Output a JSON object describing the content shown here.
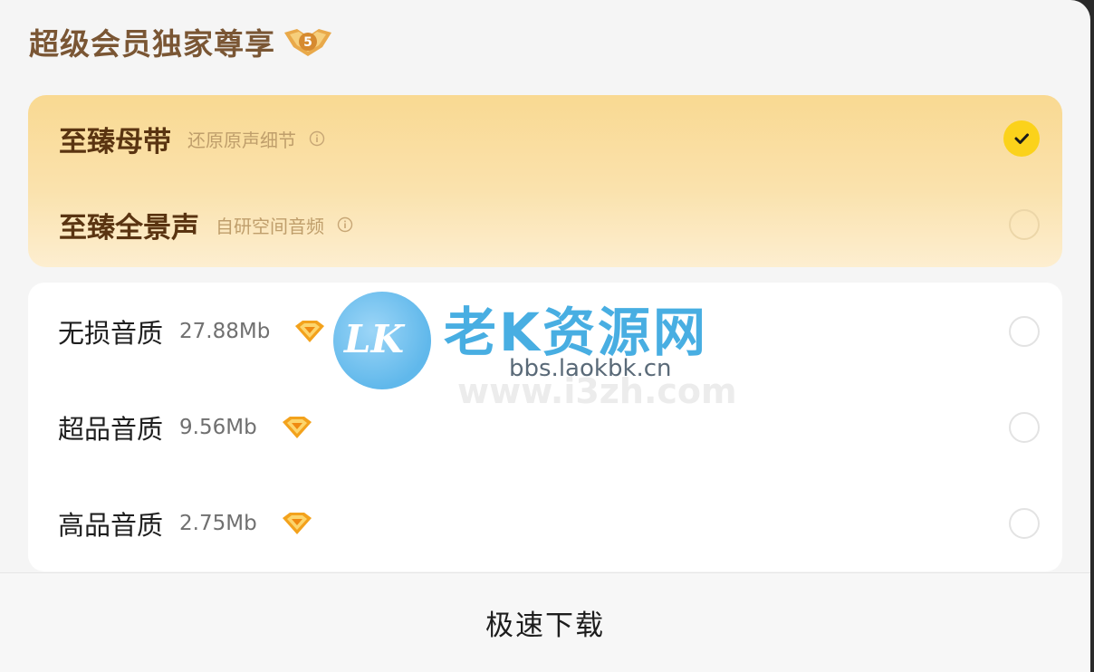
{
  "header": {
    "title": "超级会员独家尊享",
    "badge_text": "5"
  },
  "premium_options": [
    {
      "name": "至臻母带",
      "subtitle": "还原原声细节",
      "selected": true
    },
    {
      "name": "至臻全景声",
      "subtitle": "自研空间音频",
      "selected": false
    }
  ],
  "quality_options": [
    {
      "name": "无损音质",
      "size": "27.88Mb",
      "selected": false
    },
    {
      "name": "超品音质",
      "size": "9.56Mb",
      "selected": false
    },
    {
      "name": "高品音质",
      "size": "2.75Mb",
      "selected": false
    }
  ],
  "footer": {
    "button_label": "极速下载"
  },
  "watermark": {
    "logo": "LK",
    "name": "老K资源网",
    "url": "bbs.laokbk.cn",
    "url_faint": "www.i3zh.com"
  },
  "colors": {
    "accent_yellow": "#fbd21b",
    "gold_title": "#7a5634"
  }
}
